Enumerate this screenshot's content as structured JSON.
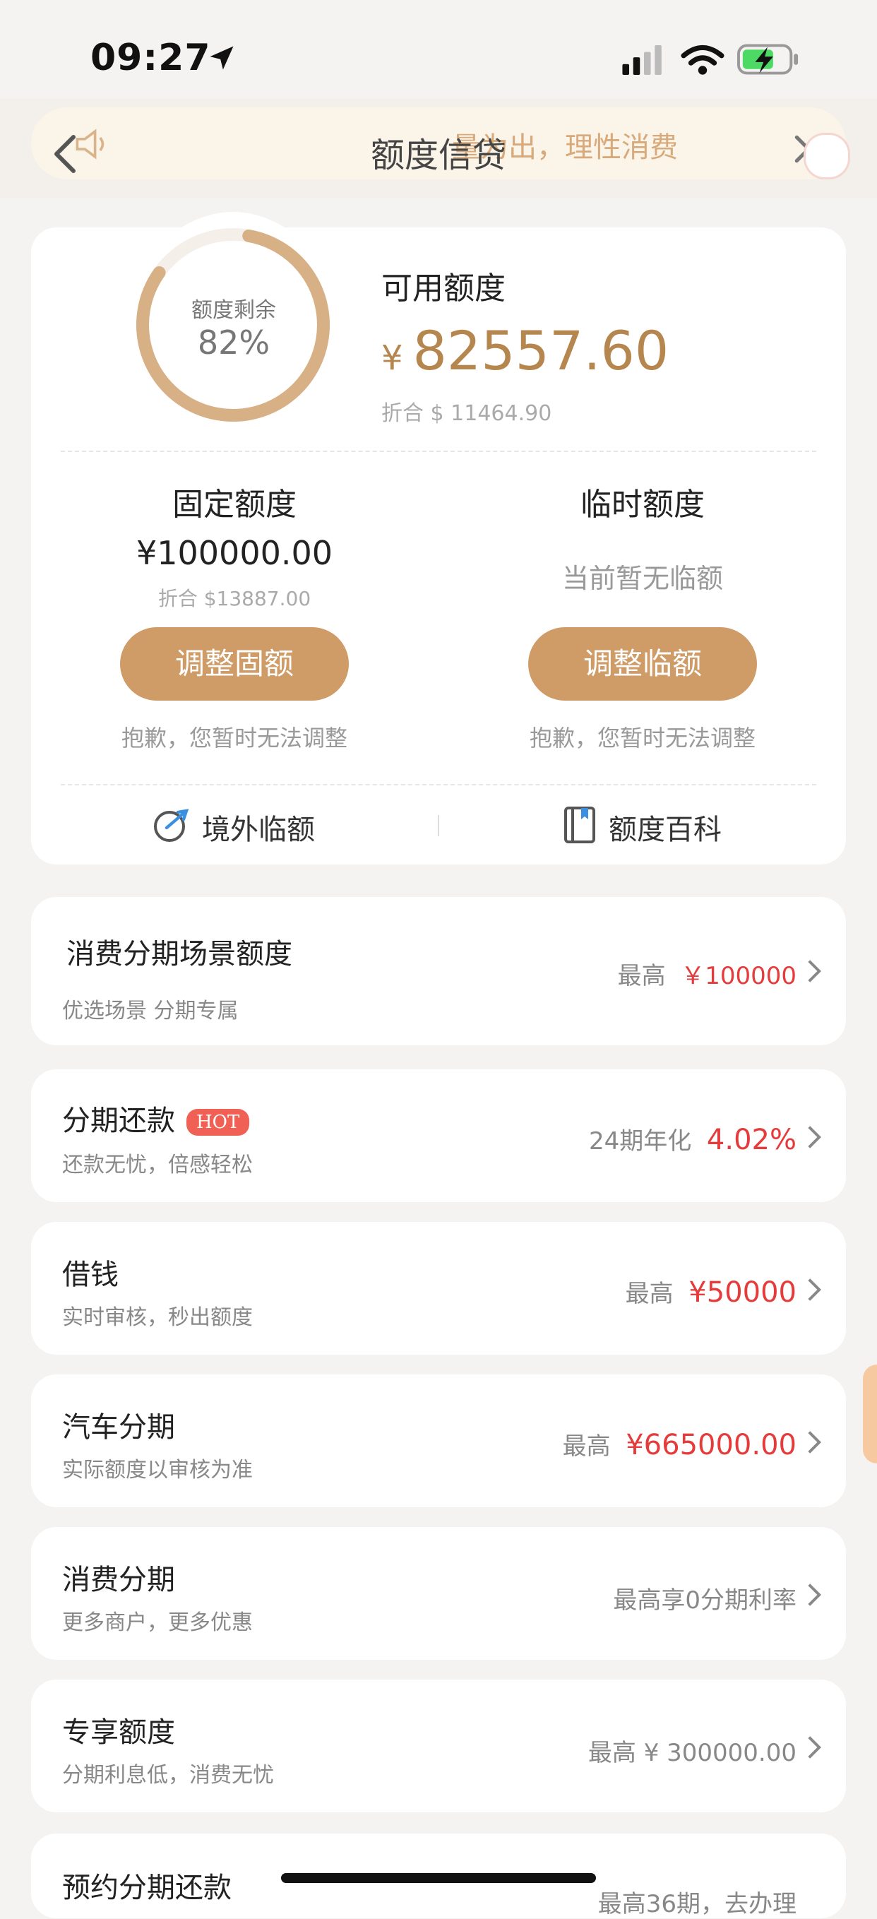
{
  "status": {
    "time": "09:27"
  },
  "header": {
    "title": "额度信贷",
    "notice": "量为出，理性消费"
  },
  "credit": {
    "ring_label": "额度剩余",
    "ring_percent": "82%",
    "ring_fraction": 0.82,
    "available_title": "可用额度",
    "currency": "¥",
    "available_amount": "82557.60",
    "available_usd": "折合 $ 11464.90",
    "fixed": {
      "title": "固定额度",
      "amount": "¥100000.00",
      "usd": "折合 $13887.00",
      "button": "调整固额",
      "hint": "抱歉，您暂时无法调整"
    },
    "temporary": {
      "title": "临时额度",
      "none_text": "当前暂无临额",
      "button": "调整临额",
      "hint": "抱歉，您暂时无法调整"
    },
    "links": {
      "overseas": "境外临额",
      "wiki": "额度百科"
    }
  },
  "list": [
    {
      "title": "消费分期场景额度",
      "subtitle": "优选场景 分期专属",
      "right_prefix": "最高",
      "right_value": "￥100000"
    },
    {
      "title": "分期还款",
      "badge": "HOT",
      "subtitle": "还款无忧，倍感轻松",
      "right_prefix": "24期年化",
      "right_value": "4.02%"
    },
    {
      "title": "借钱",
      "subtitle": "实时审核，秒出额度",
      "right_prefix": "最高",
      "right_value": "¥50000"
    },
    {
      "title": "汽车分期",
      "subtitle": "实际额度以审核为准",
      "right_prefix": "最高",
      "right_value": "¥665000.00"
    },
    {
      "title": "消费分期",
      "subtitle": "更多商户，更多优惠",
      "right_text": "最高享0分期利率"
    },
    {
      "title": "专享额度",
      "subtitle": "分期利息低，消费无忧",
      "right_text": "最高 ¥ 300000.00"
    },
    {
      "title": "预约分期还款",
      "right_text": "最高36期，去办理"
    }
  ],
  "colors": {
    "accent": "#cf9b66",
    "amount": "#b6864f",
    "red": "#e63b3b"
  }
}
